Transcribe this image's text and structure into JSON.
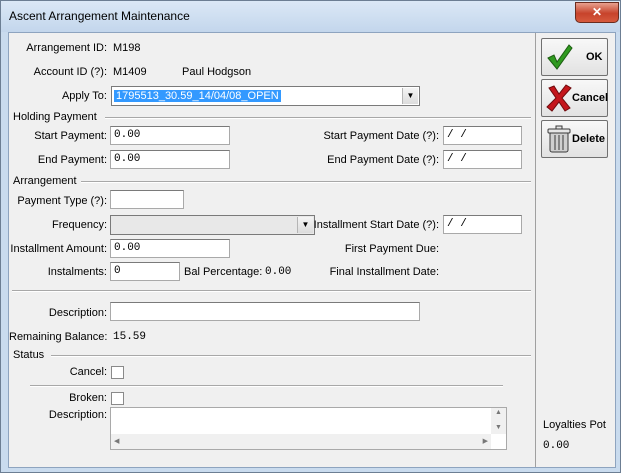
{
  "window": {
    "title": "Ascent Arrangement Maintenance",
    "close_glyph": "✕"
  },
  "header": {
    "arrangement_id_label": "Arrangement ID:",
    "arrangement_id_value": "M198",
    "account_id_label": "Account ID (?):",
    "account_id_value": "M1409",
    "account_name": "Paul  Hodgson",
    "apply_to_label": "Apply To:",
    "apply_to_value": "1795513_30.59_14/04/08_OPEN"
  },
  "holding_payment": {
    "group_title": "Holding Payment",
    "start_payment_label": "Start Payment:",
    "start_payment_value": "0.00",
    "end_payment_label": "End Payment:",
    "end_payment_value": "0.00",
    "start_payment_date_label": "Start Payment Date (?):",
    "start_payment_date_value": "  /   /",
    "end_payment_date_label": "End Payment Date (?):",
    "end_payment_date_value": "  /   /"
  },
  "arrangement": {
    "group_title": "Arrangement",
    "payment_type_label": "Payment Type (?):",
    "payment_type_value": "",
    "frequency_label": "Frequency:",
    "frequency_value": "",
    "installment_start_date_label": "Installment Start Date (?):",
    "installment_start_date_value": "  /   /",
    "installment_amount_label": "Installment Amount:",
    "installment_amount_value": "0.00",
    "first_payment_due_label": "First Payment Due:",
    "instalments_label": "Instalments:",
    "instalments_value": "0",
    "bal_percentage_label": "Bal Percentage:",
    "bal_percentage_value": "0.00",
    "final_installment_date_label": "Final Installment Date:"
  },
  "details": {
    "description_label": "Description:",
    "description_value": "",
    "remaining_balance_label": "Remaining Balance:",
    "remaining_balance_value": "15.59"
  },
  "status": {
    "group_title": "Status",
    "cancel_label": "Cancel:",
    "broken_label": "Broken:",
    "description_label": "Description:"
  },
  "side": {
    "ok_label": "OK",
    "cancel_label": "Cancel",
    "delete_label": "Delete",
    "loyalties_pot_label": "Loyalties Pot",
    "loyalties_pot_value": "0.00"
  },
  "colors": {
    "titlebar": "#c9dbee",
    "close_button": "#c7432b",
    "selection": "#3399ff",
    "ok_check": "#2f9a1f",
    "cancel_x": "#c4161c"
  },
  "icons": {
    "ok": "green-checkmark-icon",
    "cancel": "red-x-icon",
    "delete": "trash-can-icon",
    "dropdown": "chevron-down-icon"
  }
}
